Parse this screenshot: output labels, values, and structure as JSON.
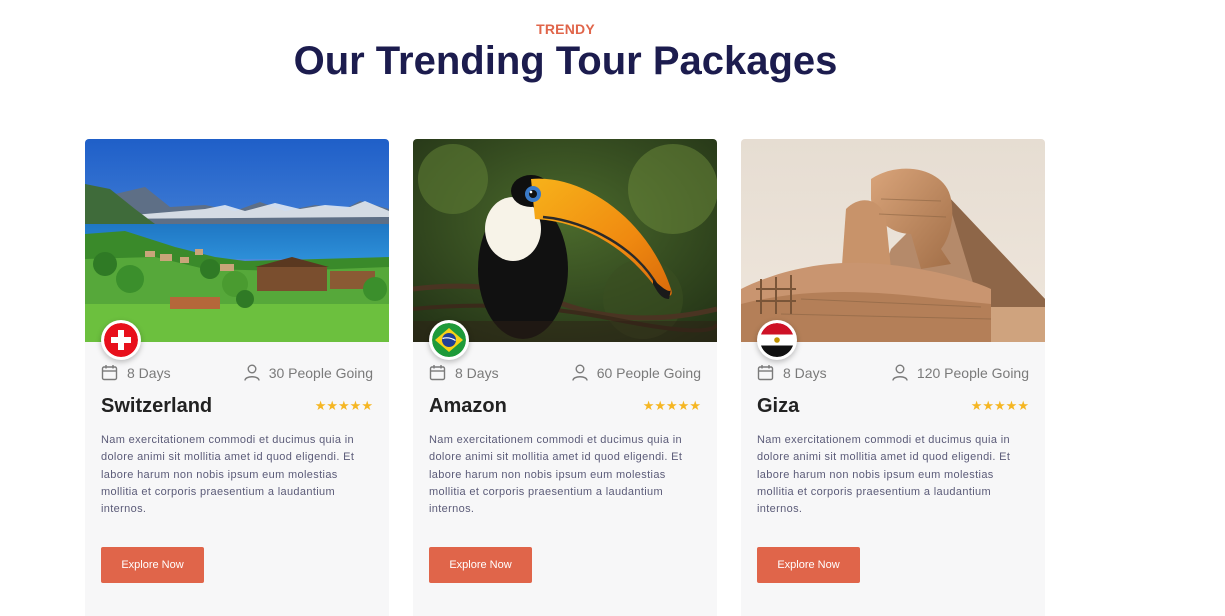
{
  "section": {
    "eyebrow": "TRENDY",
    "title": "Our Trending Tour Packages"
  },
  "cards": [
    {
      "days": "8 Days",
      "people": "30 People Going",
      "name": "Switzerland",
      "rating": 5,
      "stars": "★★★★★",
      "description": "Nam exercitationem commodi et ducimus quia in dolore animi sit mollitia amet id quod eligendi. Et labore harum non nobis ipsum eum molestias mollitia et corporis praesentium a laudantium internos.",
      "button": "Explore Now",
      "flag_icon": "swiss-flag-icon"
    },
    {
      "days": "8 Days",
      "people": "60 People Going",
      "name": "Amazon",
      "rating": 5,
      "stars": "★★★★★",
      "description": "Nam exercitationem commodi et ducimus quia in dolore animi sit mollitia amet id quod eligendi. Et labore harum non nobis ipsum eum molestias mollitia et corporis praesentium a laudantium internos.",
      "button": "Explore Now",
      "flag_icon": "brazil-flag-icon"
    },
    {
      "days": "8 Days",
      "people": "120 People Going",
      "name": "Giza",
      "rating": 5,
      "stars": "★★★★★",
      "description": "Nam exercitationem commodi et ducimus quia in dolore animi sit mollitia amet id quod eligendi. Et labore harum non nobis ipsum eum molestias mollitia et corporis praesentium a laudantium internos.",
      "button": "Explore Now",
      "flag_icon": "egypt-flag-icon"
    }
  ],
  "colors": {
    "accent": "#e0654a",
    "title": "#1c1c4e",
    "star": "#f5b623",
    "card_bg": "#f7f7f8"
  }
}
